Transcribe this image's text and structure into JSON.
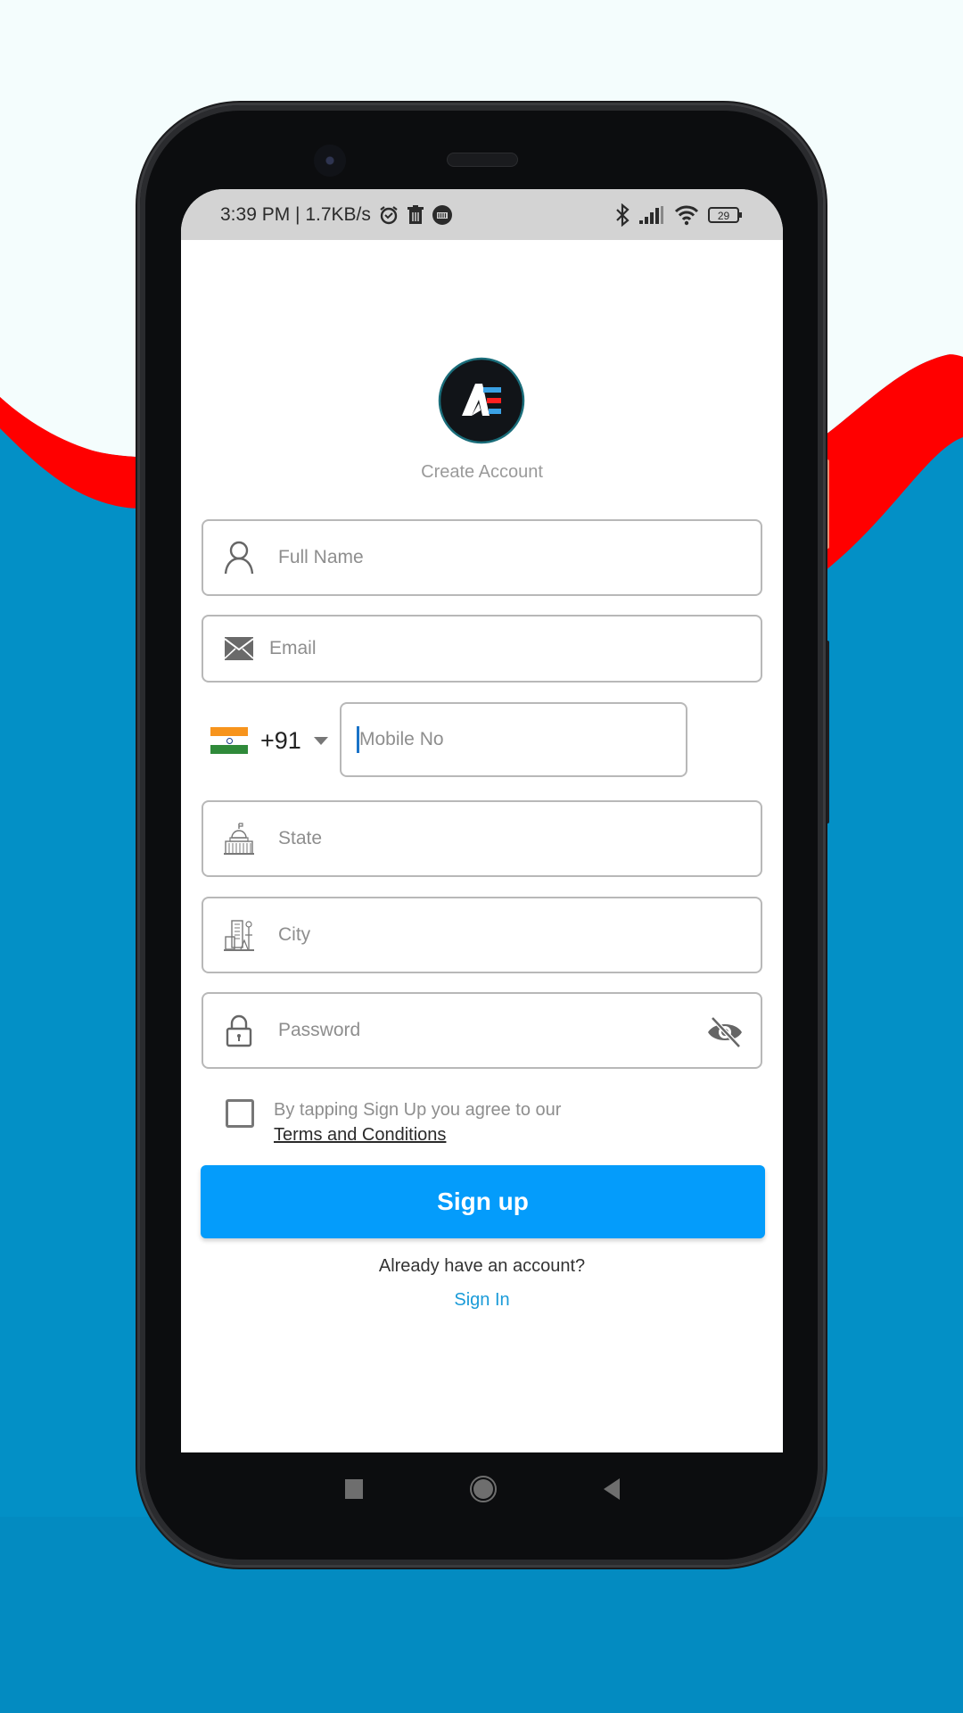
{
  "theme": {
    "background_top": "#f4fdfd",
    "wave_red": "#ff0000",
    "background_blue": "#0390c6",
    "accent": "#049cfb",
    "link": "#1a9bd8"
  },
  "statusbar": {
    "time_speed": "3:39 PM | 1.7KB/s",
    "left_icons": [
      "alarm-icon",
      "trash-icon",
      "app-notification-icon"
    ],
    "right_icons": [
      "bluetooth-icon",
      "signal-icon",
      "wifi-icon",
      "battery-icon"
    ],
    "battery": "29"
  },
  "header": {
    "logo_text": "AE",
    "title": "Create Account"
  },
  "form": {
    "full_name": {
      "placeholder": "Full Name",
      "value": "",
      "icon": "user-icon"
    },
    "email": {
      "placeholder": "Email",
      "value": "",
      "icon": "mail-icon"
    },
    "mobile": {
      "country_flag": "india-flag-icon",
      "country_code": "+91",
      "placeholder": "Mobile No",
      "value": ""
    },
    "state": {
      "placeholder": "State",
      "value": "",
      "icon": "capitol-building-icon"
    },
    "city": {
      "placeholder": "City",
      "value": "",
      "icon": "city-buildings-icon"
    },
    "password": {
      "placeholder": "Password",
      "value": "",
      "icon": "lock-icon",
      "toggle_icon": "eye-off-icon"
    },
    "terms": {
      "checked": false,
      "text": "By tapping Sign Up you agree to our",
      "link": "Terms and Conditions"
    },
    "submit_label": "Sign up"
  },
  "footer": {
    "prompt": "Already have an account?",
    "signin_label": "Sign In"
  },
  "navbar": {
    "items": [
      "recents-button",
      "home-button",
      "back-button"
    ]
  }
}
